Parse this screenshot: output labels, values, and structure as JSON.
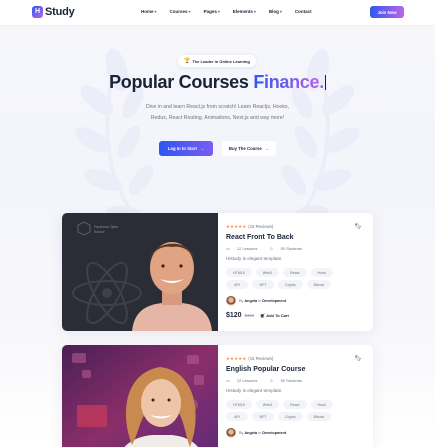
{
  "header": {
    "logo_text": "Study",
    "logo_mark": "H",
    "nav": [
      {
        "label": "Home"
      },
      {
        "label": "Courses"
      },
      {
        "label": "Pages"
      },
      {
        "label": "Elements"
      },
      {
        "label": "Blog"
      },
      {
        "label": "Contact"
      }
    ],
    "join_label": "Join Now"
  },
  "hero": {
    "badge_icon": "trophy-icon",
    "badge": "The Leader in Online Learning",
    "title_main": "Popular Courses ",
    "title_accent": "Finance.",
    "description": "Dive in and learn React.js from scratch! Learn Reactjs, Hooks, Redux, React Routing, Animations, Next.js and way more!",
    "primary_button": "Log In to Start",
    "secondary_button": "Buy The Course"
  },
  "courses": [
    {
      "rating_stars": "★★★★★",
      "reviews": "(15 Reviews)",
      "title": "React Front To Back",
      "lessons": "12 Lessons",
      "students": "50 Students",
      "description": "Histudy is elegant template.",
      "tags": [
        "HTML5",
        "Web3",
        "React",
        "Hook",
        "API",
        "NFT",
        "Crypto",
        "Bitcoin"
      ],
      "author_prefix": "By",
      "author": "Angela",
      "category_prefix": "In",
      "category": "Development",
      "price": "$120",
      "old_price": "$150",
      "cart_label": "Add To Cart",
      "image_caption": "Facebook Open Source"
    },
    {
      "rating_stars": "★★★★★",
      "reviews": "(15 Reviews)",
      "title": "English Popular Course",
      "lessons": "12 Lessons",
      "students": "50 Students",
      "description": "Histudy is elegant template.",
      "tags": [
        "HTML5",
        "Web3",
        "React",
        "Hook",
        "API",
        "NFT",
        "Crypto",
        "Bitcoin"
      ],
      "author_prefix": "By",
      "author": "Angela",
      "category_prefix": "In",
      "category": "Development"
    }
  ],
  "colors": {
    "primary": "#2f57ef",
    "secondary": "#b966e7",
    "heading": "#192335",
    "body": "#6b7385",
    "star": "#ff8f3c"
  }
}
